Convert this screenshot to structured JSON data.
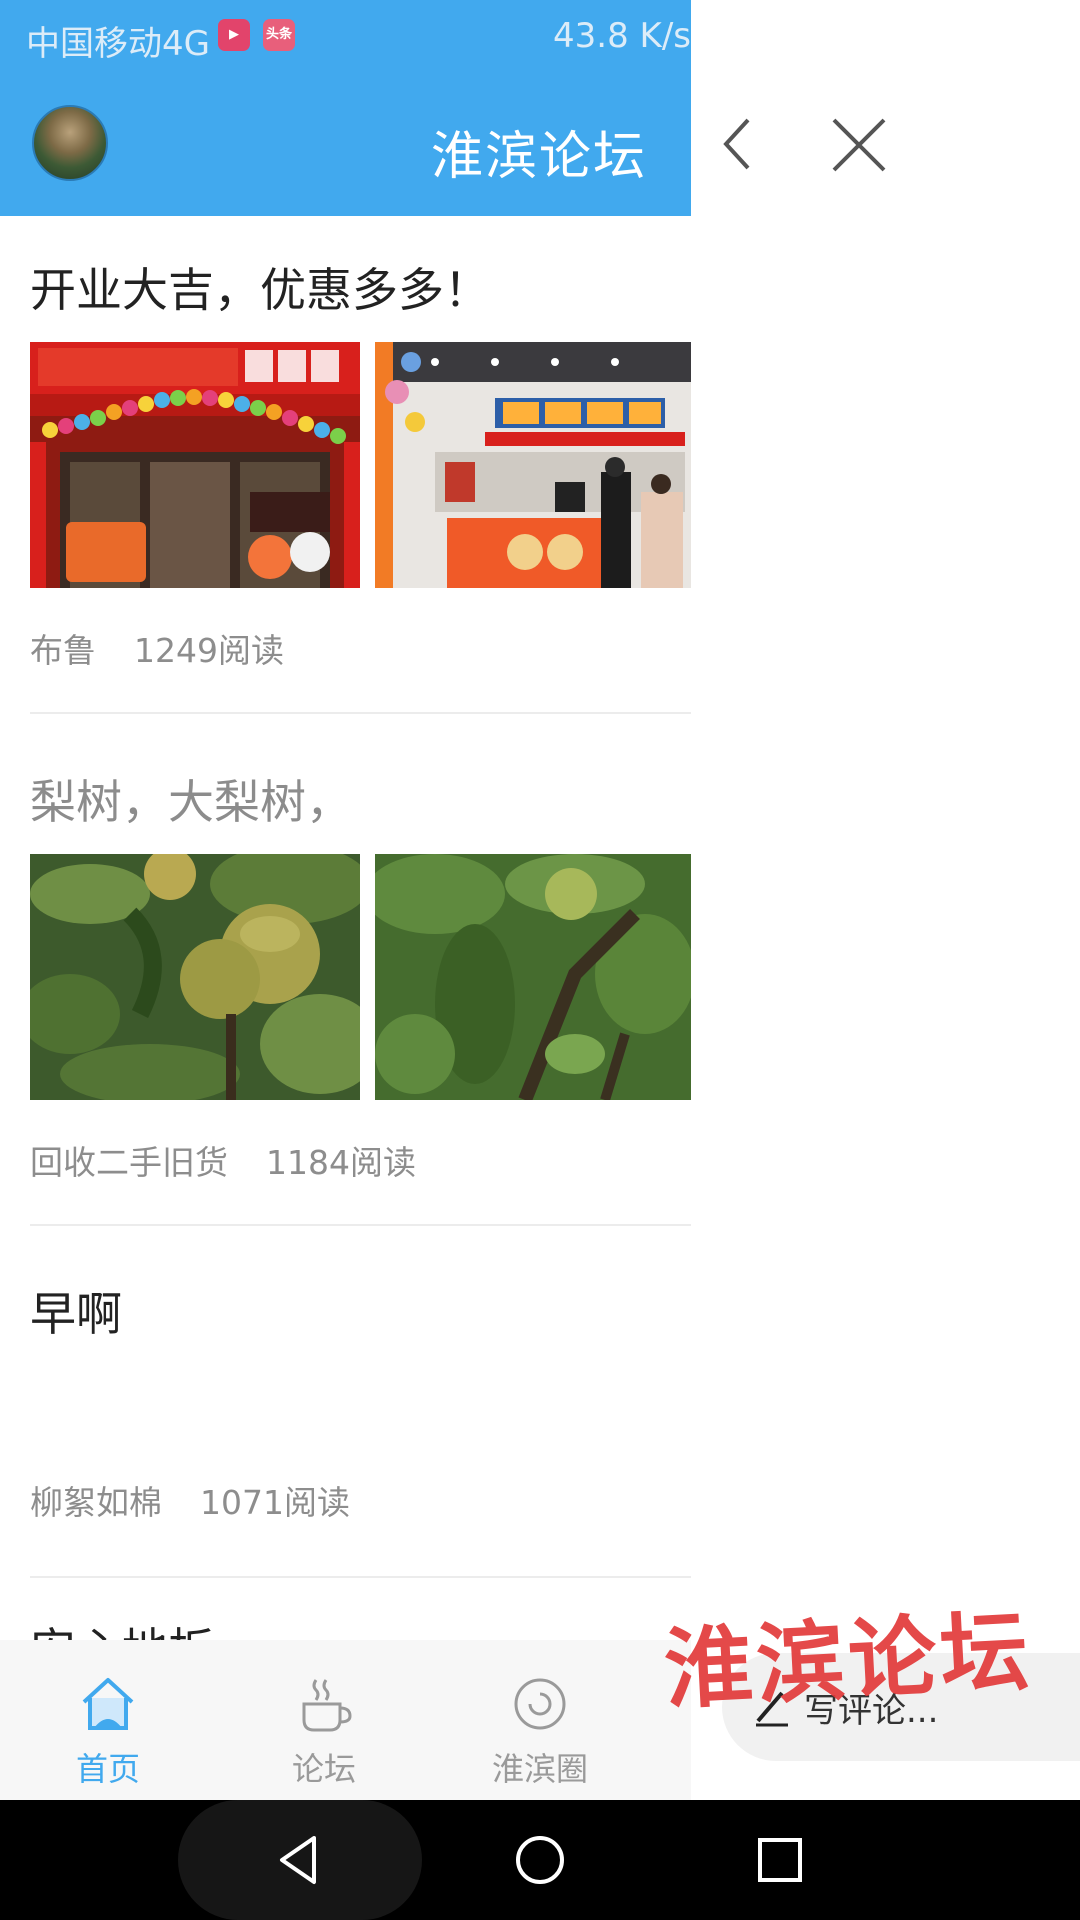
{
  "status_bar": {
    "carrier": "中国移动4G",
    "badge1": "▶",
    "badge2": "头条",
    "speed": "43.8 K/s"
  },
  "header": {
    "title": "淮滨论坛"
  },
  "posts": [
    {
      "title": "开业大吉，优惠多多！",
      "author": "布鲁",
      "reads": "1249阅读"
    },
    {
      "title": "梨树，大梨树，",
      "author": "回收二手旧货",
      "reads": "1184阅读"
    },
    {
      "title": "早啊",
      "author": "柳絮如棉",
      "reads": "1071阅读"
    },
    {
      "title": "安心地板"
    }
  ],
  "tabs": [
    {
      "label": "首页",
      "icon": "home-icon"
    },
    {
      "label": "论坛",
      "icon": "coffee-cup-icon"
    },
    {
      "label": "淮滨圈",
      "icon": "circle-icon"
    }
  ],
  "comment": {
    "placeholder": "写评论..."
  },
  "watermark": "淮滨论坛",
  "colors": {
    "accent": "#41a9ee",
    "watermark": "#e23a3a"
  }
}
